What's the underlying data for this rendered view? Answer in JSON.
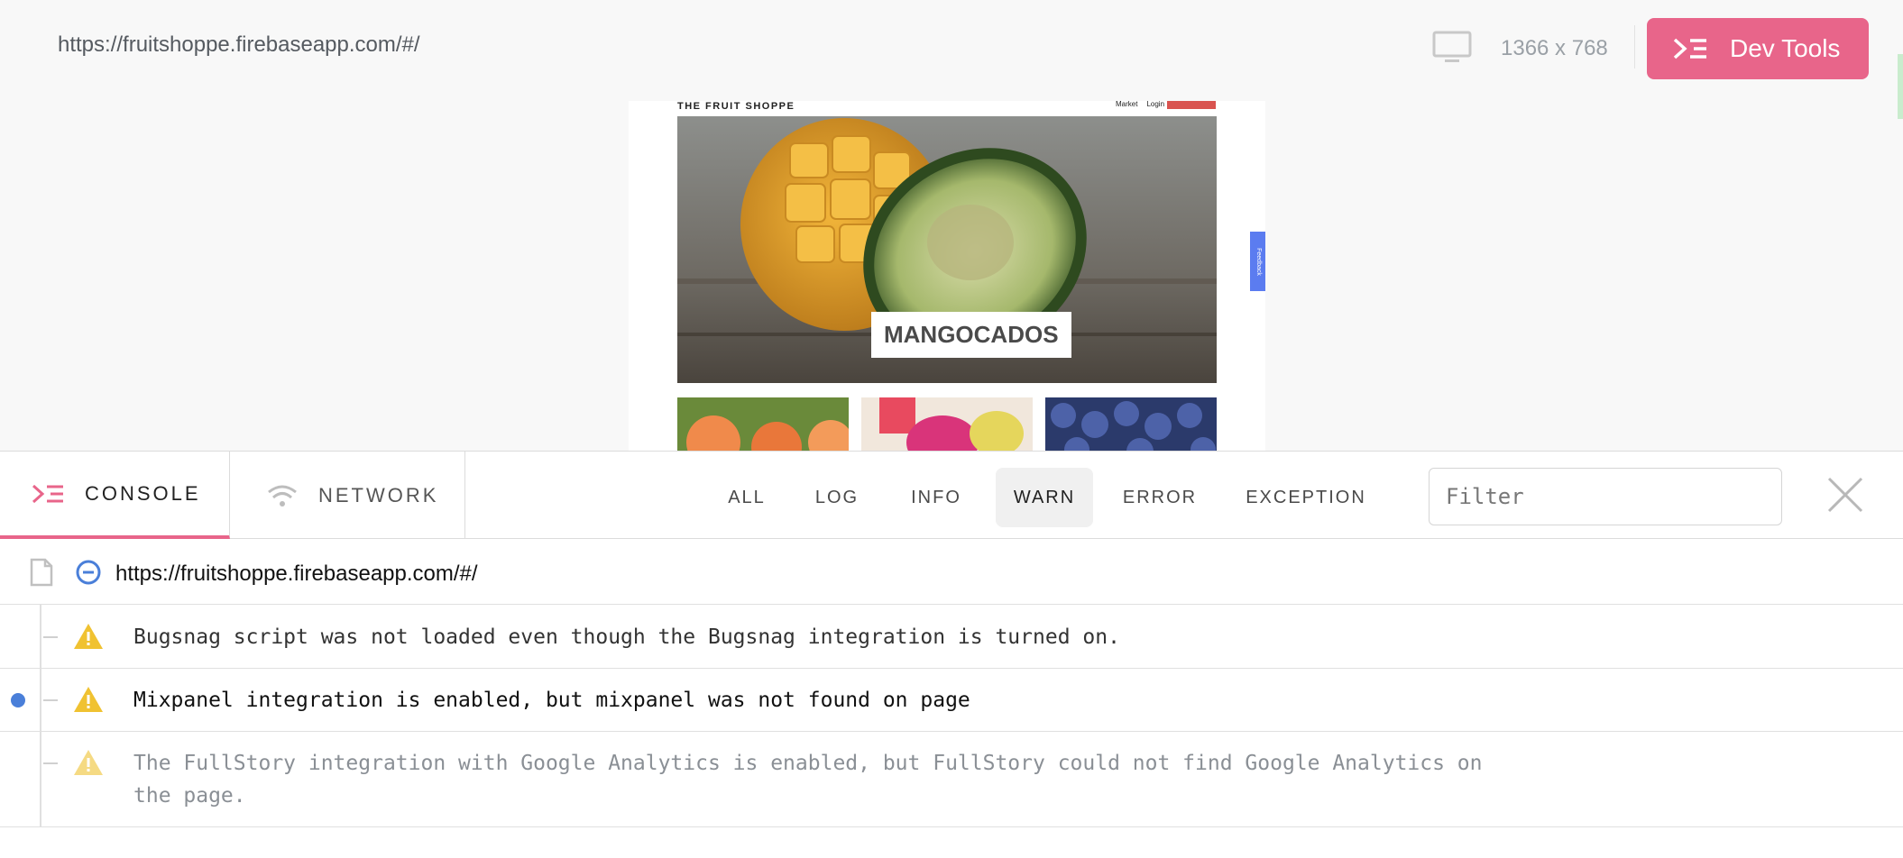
{
  "topbar": {
    "url": "https://fruitshoppe.firebaseapp.com/#/",
    "resolution": "1366 x 768",
    "devtools_label": "Dev Tools"
  },
  "preview": {
    "brand": "THE FRUIT SHOPPE",
    "menu": [
      "Market",
      "Login"
    ],
    "hero_label": "MANGOCADOS",
    "feedback_label": "Feedback"
  },
  "panel": {
    "tabs": [
      {
        "label": "CONSOLE",
        "icon": "console-icon",
        "active": true
      },
      {
        "label": "NETWORK",
        "icon": "wifi-icon",
        "active": false
      }
    ],
    "levels": [
      "ALL",
      "LOG",
      "INFO",
      "WARN",
      "ERROR",
      "EXCEPTION"
    ],
    "active_level": "WARN",
    "filter_placeholder": "Filter",
    "page_url": "https://fruitshoppe.firebaseapp.com/#/",
    "logs": [
      {
        "level": "warn",
        "message": "Bugsnag script was not loaded even though the Bugsnag integration is turned on.",
        "selected": false,
        "faded": false
      },
      {
        "level": "warn",
        "message": "Mixpanel integration is enabled, but mixpanel was not found on page",
        "selected": true,
        "faded": false
      },
      {
        "level": "warn",
        "message_line1": "The FullStory integration with Google Analytics is enabled, but FullStory could not find Google Analytics on",
        "message_line2": "the page.",
        "selected": false,
        "faded": true
      }
    ]
  },
  "colors": {
    "accent": "#e8658a",
    "warn": "#f0c231",
    "link_blue": "#4a7fd9"
  }
}
